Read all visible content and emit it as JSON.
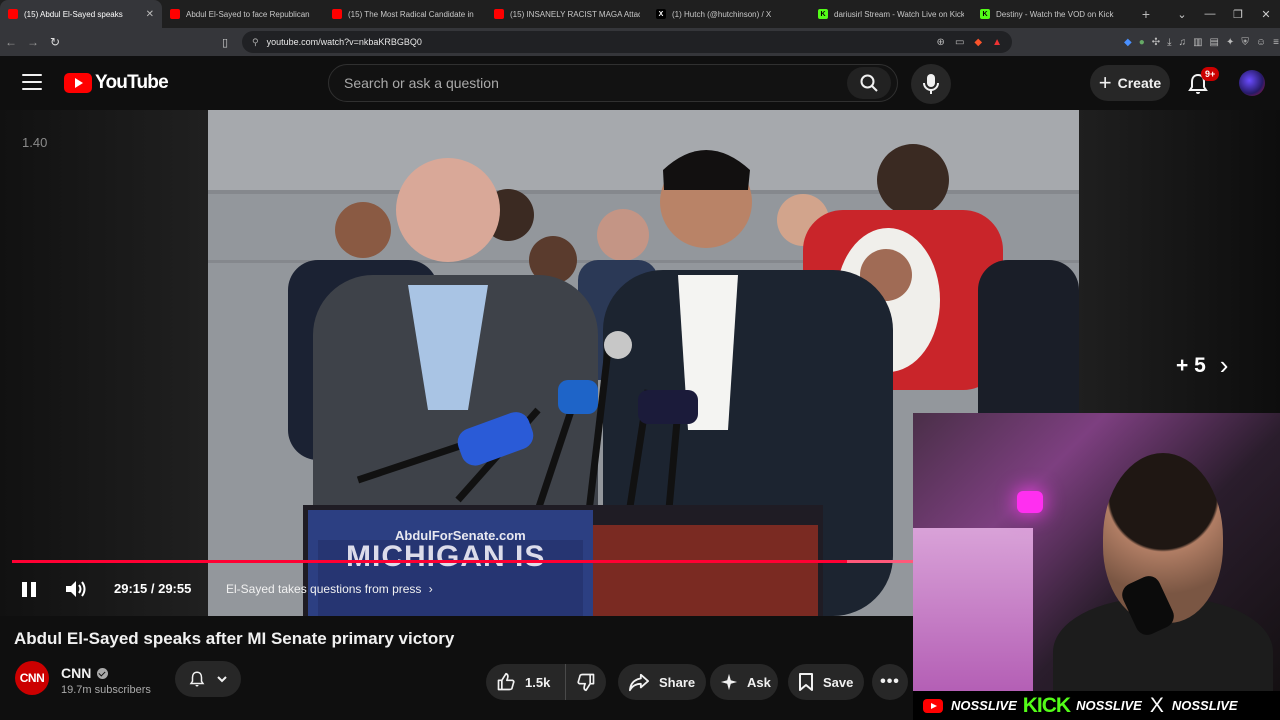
{
  "browser": {
    "tabs": [
      {
        "title": "(15) Abdul El-Sayed speaks",
        "icon": "youtube-icon",
        "active": true
      },
      {
        "title": "Abdul El-Sayed to face Republican",
        "icon": "youtube-icon",
        "active": false
      },
      {
        "title": "(15) The Most Radical Candidate in",
        "icon": "youtube-icon",
        "active": false
      },
      {
        "title": "(15) INSANELY RACIST MAGA Attac",
        "icon": "youtube-icon",
        "active": false
      },
      {
        "title": "(1) Hutch (@hutchinson) / X",
        "icon": "x-icon",
        "active": false
      },
      {
        "title": "dariusirl Stream - Watch Live on Kick",
        "icon": "kick-icon",
        "active": false
      },
      {
        "title": "Destiny - Watch the VOD on Kick",
        "icon": "kick-icon",
        "active": false
      }
    ],
    "url": "youtube.com/watch?v=nkbaKRBGBQ0"
  },
  "header": {
    "logo_text": "YouTube",
    "search_placeholder": "Search or ask a question",
    "create_label": "Create",
    "notification_count": "9+"
  },
  "player": {
    "speed_overlay": "1.40",
    "more_overlay": "+ 5",
    "time_display": "29:15 / 29:55",
    "progress": 0.977,
    "chapter_label": "El-Sayed takes questions from press",
    "chapter_chevron": "›"
  },
  "stream_bar": {
    "handle_youtube": "NOSSLIVE",
    "kick_logo": "KICK",
    "handle_kick": "NOSSLIVE",
    "handle_x": "NOSSLIVE"
  },
  "video": {
    "title": "Abdul El-Sayed speaks after MI Senate primary victory",
    "channel_name": "CNN",
    "channel_avatar_text": "CNN",
    "subscribers": "19.7m subscribers",
    "like_count": "1.5k",
    "share_label": "Share",
    "ask_label": "Ask",
    "save_label": "Save"
  },
  "colors": {
    "accent": "#ff0033",
    "brand_red": "#ff0000",
    "kick_green": "#53fc18"
  }
}
